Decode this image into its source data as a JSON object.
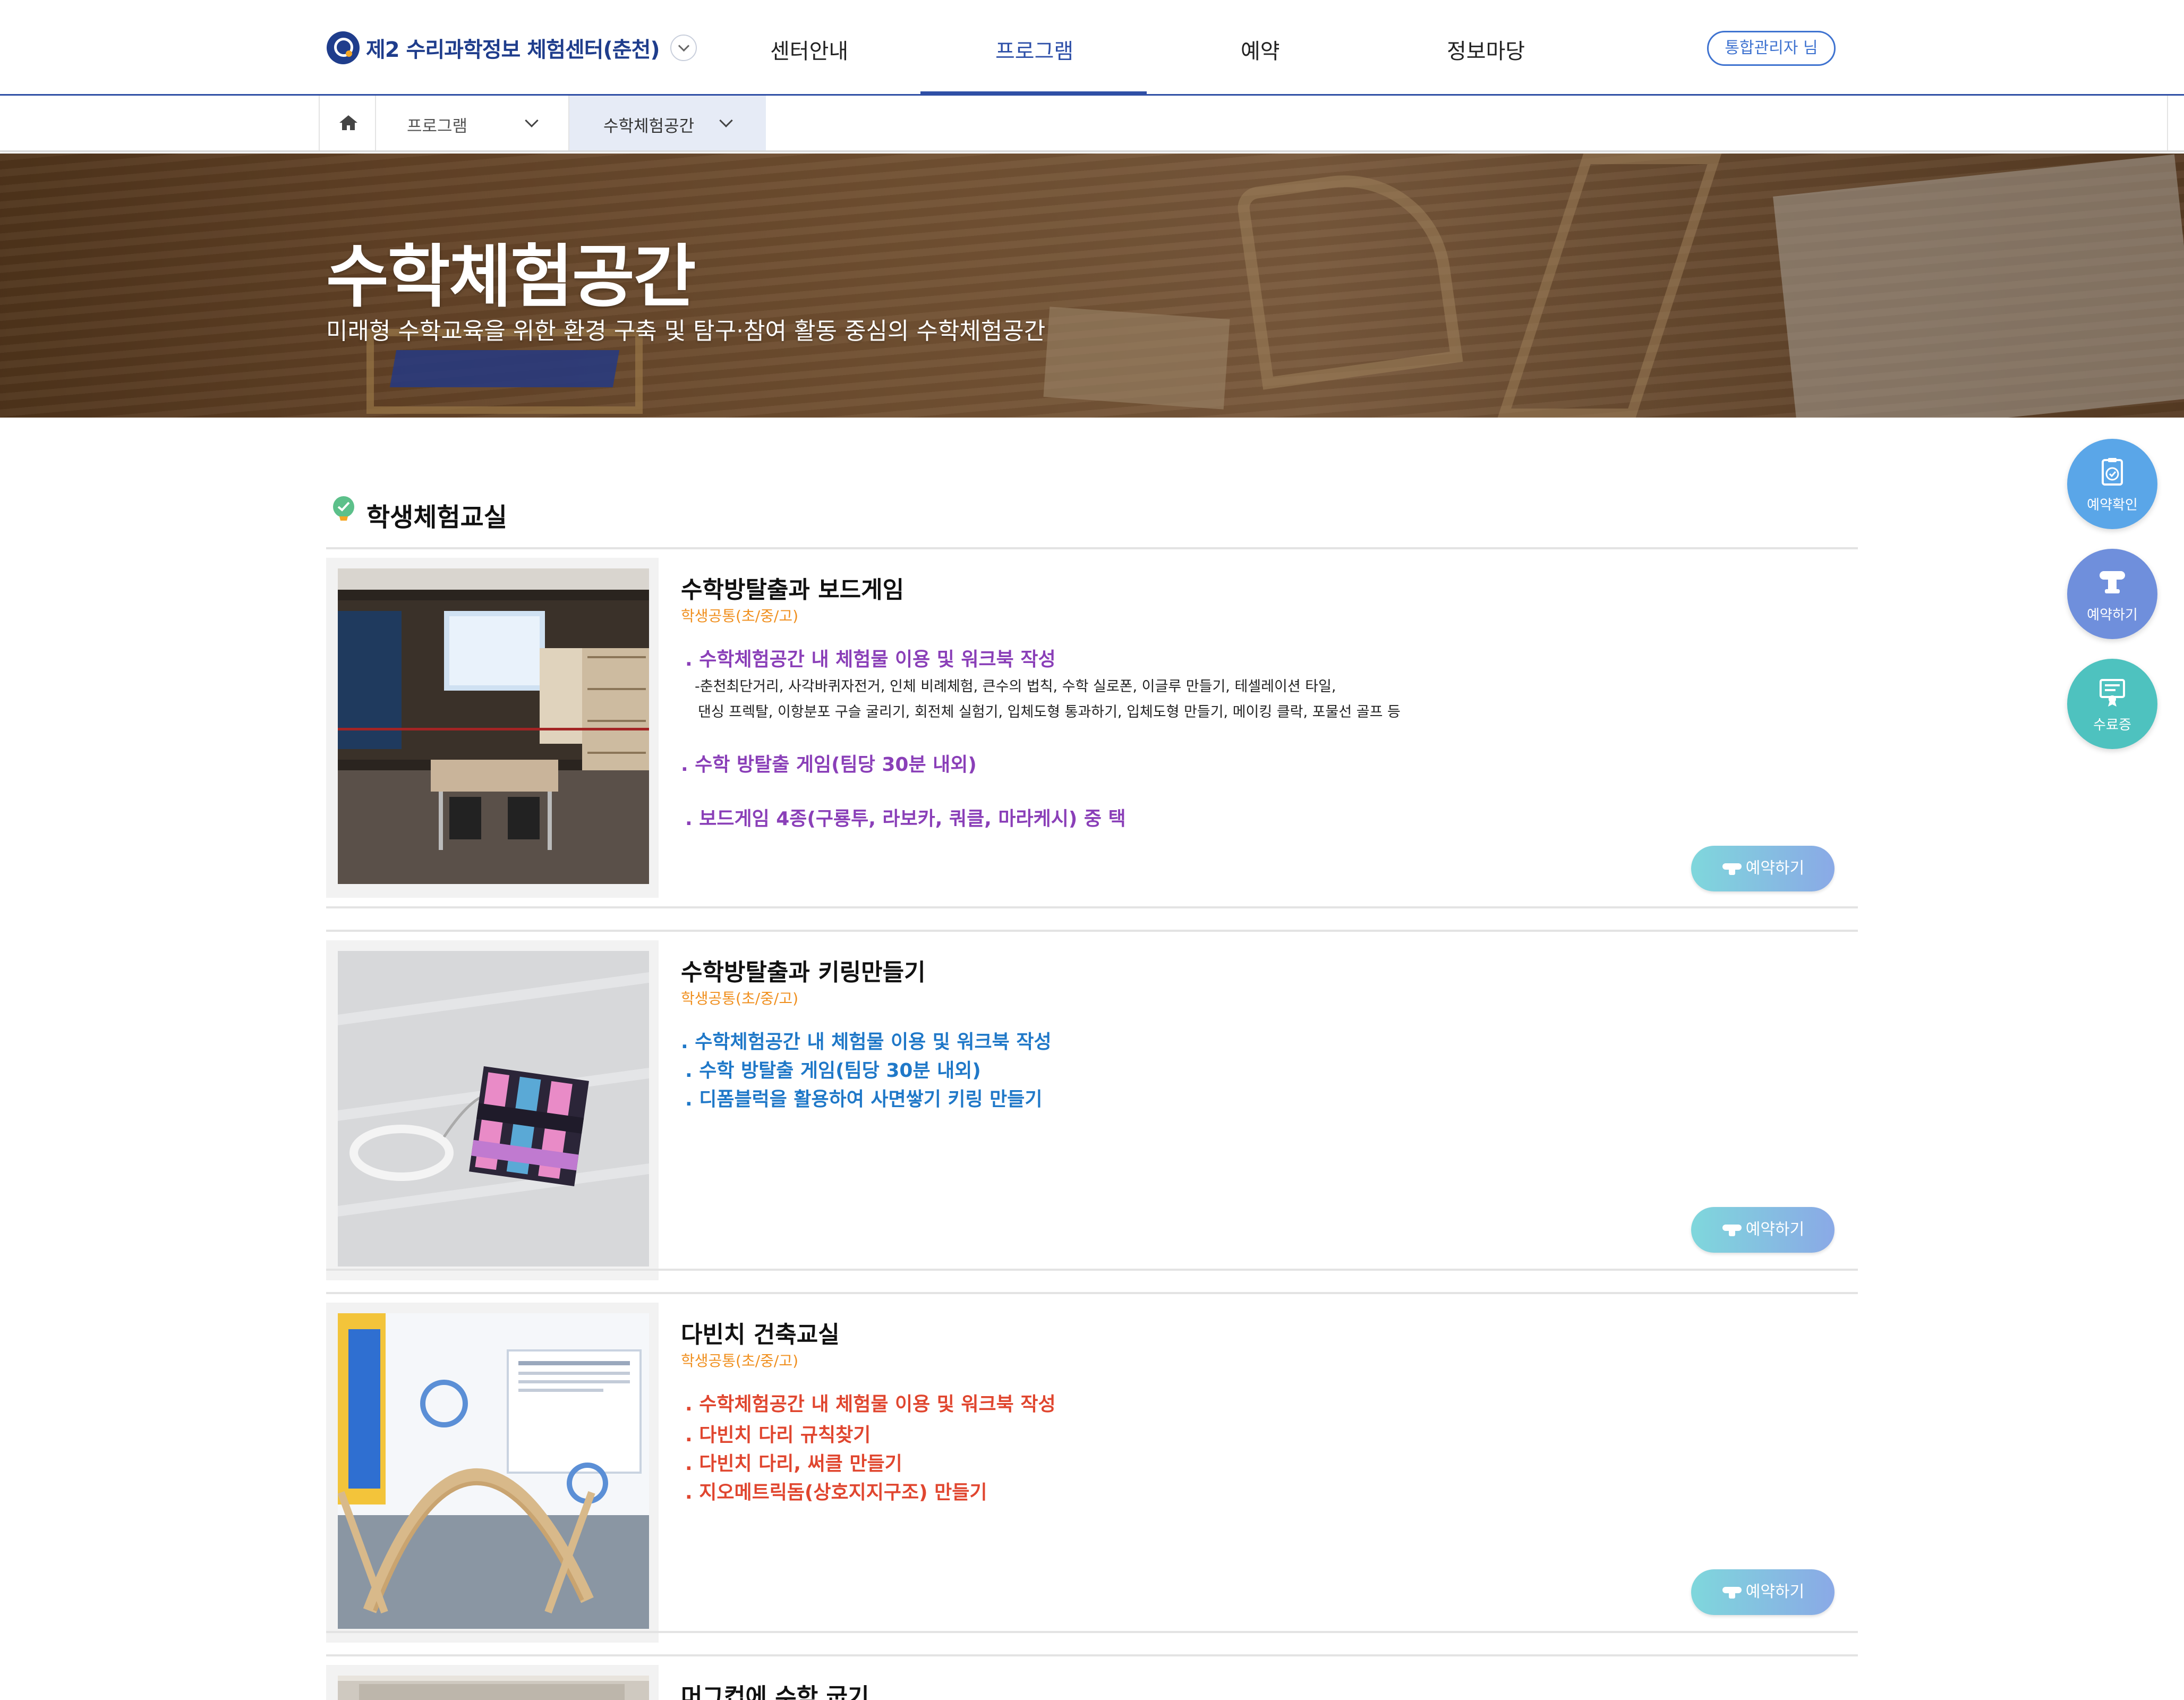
{
  "header": {
    "logo_text": "제2 수리과학정보 체험센터(춘천)",
    "nav": [
      "센터안내",
      "프로그램",
      "예약",
      "정보마당"
    ],
    "active_nav": "프로그램",
    "admin_label": "통합관리자 님"
  },
  "breadcrumb": {
    "home_icon": "home-icon",
    "items": [
      "프로그램",
      "수학체험공간"
    ]
  },
  "hero": {
    "title": "수학체험공간",
    "subtitle": "미래형 수학교육을 위한 환경 구축 및 탐구·참여 활동 중심의 수학체험공간"
  },
  "section": {
    "title": "학생체험교실"
  },
  "programs": [
    {
      "title": "수학방탈출과 보드게임",
      "target": "학생공통(초/중/고)",
      "line1": ". 수학체험공간 내 체험물 이용 및 워크북 작성",
      "detail1": "-춘천최단거리, 사각바퀴자전거, 인체 비례체험, 큰수의 법칙, 수학 실로폰, 이글루 만들기, 테셀레이션 타일,",
      "detail2": "댄싱 프렉탈, 이항분포 구슬 굴리기, 회전체 실험기, 입체도형 통과하기, 입체도형 만들기, 메이킹 클락, 포물선 골프 등",
      "line2": ". 수학 방탈출 게임(팀당 30분 내외)",
      "line3": ". 보드게임 4종(구룡투, 라보카, 쿼클, 마라케시) 중 택",
      "button": "예약하기"
    },
    {
      "title": "수학방탈출과 키링만들기",
      "target": "학생공통(초/중/고)",
      "line1": ". 수학체험공간 내 체험물 이용 및 워크북 작성",
      "line2": ". 수학 방탈출 게임(팀당 30분 내외)",
      "line3": ". 디폼블럭을 활용하여 사면쌓기 키링 만들기",
      "button": "예약하기"
    },
    {
      "title": "다빈치 건축교실",
      "target": "학생공통(초/중/고)",
      "line1": ". 수학체험공간 내 체험물 이용 및 워크북 작성",
      "line2": ". 다빈치 다리 규칙찾기",
      "line3": ". 다빈치 다리, 써클 만들기",
      "line4": ". 지오메트릭돔(상호지지구조) 만들기",
      "button": "예약하기"
    },
    {
      "title": "머그컵에 수학 굽기"
    }
  ],
  "quick_menu": [
    {
      "label": "예약확인",
      "icon": "clipboard-check-icon",
      "color": "#5aa6e8"
    },
    {
      "label": "예약하기",
      "icon": "hand-phone-icon",
      "color": "#6f8fdc"
    },
    {
      "label": "수료증",
      "icon": "certificate-icon",
      "color": "#4ec2bf"
    }
  ],
  "colors": {
    "brand": "#1f3d8c",
    "accent_orange": "#f08f1e",
    "purple_text": "#8a3fb8",
    "blue_text": "#1f78c8",
    "red_text": "#e0462f"
  }
}
